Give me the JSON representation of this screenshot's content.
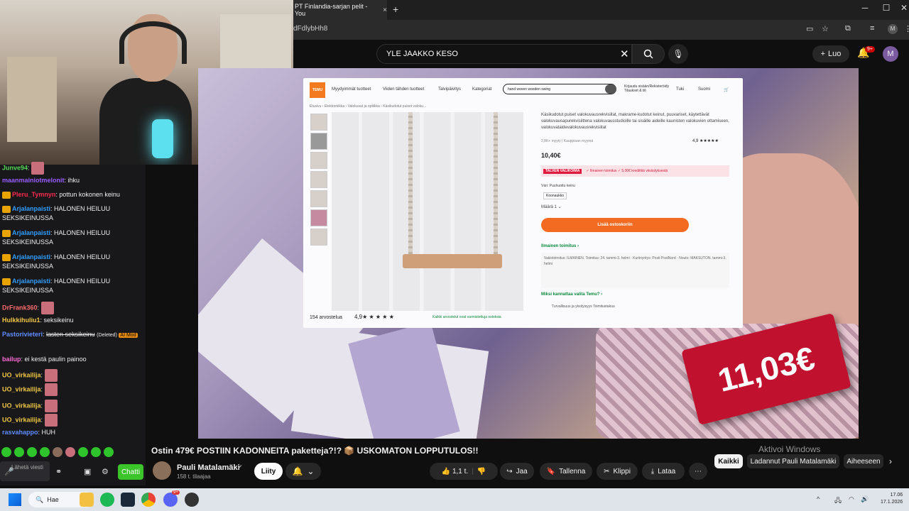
{
  "browser": {
    "tab_title": "PT Finlandia-sarjan pelit - You",
    "tab_close": "×",
    "new_tab": "+",
    "url": "dFdlybHh8",
    "win_min": "─",
    "win_max": "☐",
    "win_close": "✕"
  },
  "youtube": {
    "search_value": "YLE JAAKKO KESO",
    "create_label": "Luo",
    "notif_count": "9+",
    "avatar_letter": "M"
  },
  "video": {
    "price_overlay": "11,03€",
    "title": "Ostin 479€ POSTIIN KADONNEITA paketteja?!? 📦 USKOMATON LOPPUTULOS!!",
    "channel_name": "Pauli Matalamäki",
    "subscribers": "158 t. tilaajaa",
    "join_label": "Liity",
    "likes": "1,1 t.",
    "share_label": "Jaa",
    "save_label": "Tallenna",
    "clip_label": "Klippi",
    "download_label": "Lataa"
  },
  "temu": {
    "logo": "TEMU",
    "nav": [
      "Myydyimmät tuotteet",
      "Viiden tähden tuotteet",
      "Talvipäivitys",
      "Kategoriat"
    ],
    "search_value": "hand woven wooden swing",
    "account": "Kirjaudu sisään/Rekisteröidy Tilaukset & tili",
    "support": "Tuki",
    "lang": "Suomi",
    "breadcrumb": "Etusivu › Elektroniikka › Valokuvat ja optiikka › Käsikudotut puiset valoku...",
    "title": "Käsikudotut puiset valokuvausrekvisiitat, makrame-kudotut keinut, puuvariset, käytettävät valokuvausapurekvisiittena valokuvausstudioille tai sisäille aideille kaunisten valokuvien ottamiseen, valokuvataidevalokuvausrekvisiitat",
    "sold": "2,8K+ myyty | Kauppiaan myymä",
    "score": "4,9 ★★★★★",
    "price": "10,40€",
    "promo_badge": "TALVEN VALIKOIMA",
    "promo_text": "✓ Ilmainen toimitus  ✓ 5,00€ krediittiä viivästyksestä",
    "color_label": "Väri: Puuhuottu keinu",
    "color_option": "Koonaukko",
    "qty": "Määrä   1  ⌄",
    "cart_button": "Lisää ostoskoriin",
    "free_shipping": "Ilmainen toimitus ›",
    "ship_details": "Vakiotoimitus: ILMAINEN. Toimitus: 24. tammi-3. helmi · Kuriiriyritys: Posti PostNord · Nouto: MAKSUTON. tammi-3. helmi",
    "why": "Miksi kannattaa valita Temu? ›",
    "safety": "Turvallisuus ja yksityisyys   Toimitustakuu",
    "reviews": "154 arvostelua",
    "rating": "4,9★ ★ ★ ★ ★",
    "verified": "Kaikki arvostelut ovat varmistettuja ostoksia"
  },
  "chat": {
    "messages": [
      {
        "user": "Junve94",
        "text": "",
        "color": "#58d85a"
      },
      {
        "user": "maanmainiotmelonit",
        "text": "ihku",
        "color": "#9b5cff"
      },
      {
        "user": "Pleru_Tymnyn",
        "text": "pottun kokonen keinu",
        "color": "#ff2a4f"
      },
      {
        "user": "Arjalanpaisti",
        "text": "HALONEN HEILUU SEKSIKEINUSSA",
        "color": "#2f9dfc"
      },
      {
        "user": "Arjalanpaisti",
        "text": "HALONEN HEILUU SEKSIKEINUSSA",
        "color": "#2f9dfc"
      },
      {
        "user": "Arjalanpaisti",
        "text": "HALONEN HEILUU SEKSIKEINUSSA",
        "color": "#2f9dfc"
      },
      {
        "user": "Arjalanpaisti",
        "text": "HALONEN HEILUU SEKSIKEINUSSA",
        "color": "#2f9dfc"
      },
      {
        "user": "DrFrank360",
        "text": "",
        "color": "#ff6b6b"
      },
      {
        "user": "Hulkkihuliu1",
        "text": "seksikeinu",
        "color": "#f2c744"
      },
      {
        "user": "Pastorivieteri",
        "text": "lasten seksikeinu",
        "deleted": "(Deleted)",
        "mod": "AI Mod",
        "color": "#5f8cff"
      },
      {
        "user": "bailup",
        "text": "ei kestä paulin painoo",
        "color": "#ff6bd5"
      },
      {
        "user": "UO_virkailija",
        "text": "",
        "color": "#f2c744"
      },
      {
        "user": "UO_virkailija",
        "text": "",
        "color": "#f2c744"
      },
      {
        "user": "UO_virkailija",
        "text": "",
        "color": "#f2c744"
      },
      {
        "user": "UO_virkailija",
        "text": "",
        "color": "#f2c744"
      },
      {
        "user": "rasvahappo",
        "text": "HUH",
        "color": "#5f8cff"
      }
    ],
    "input_placeholder": "Lähetä viesti",
    "send_label": "Chatti"
  },
  "chips": {
    "all": "Kaikki",
    "uploader": "Ladannut Pauli Matalamäki",
    "related": "Aiheeseen"
  },
  "watermark": "Aktivoi Windows",
  "taskbar": {
    "search": "Hae",
    "time": "17.06",
    "date": "17.1.2026",
    "discord_badge": "9+"
  },
  "colors": {
    "accent_red": "#c0122f",
    "chat_green": "#3cc42b",
    "temu_orange": "#f36b21"
  }
}
